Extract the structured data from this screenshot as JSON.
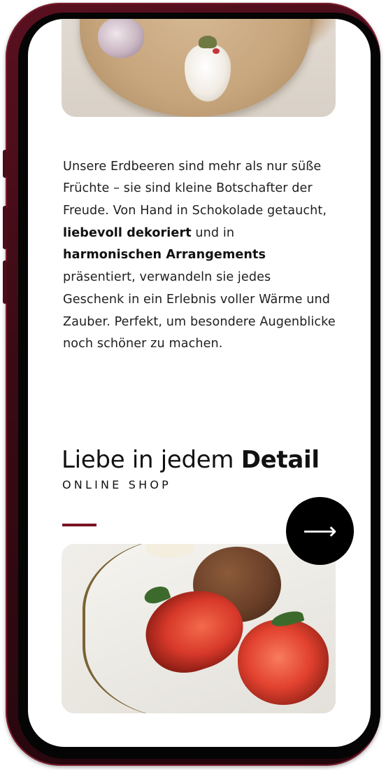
{
  "paragraph": {
    "part1": "Unsere Erdbeeren sind mehr als nur süße Früchte – sie sind kleine Botschafter der Freude. Von Hand in Schokolade getaucht, ",
    "bold1": "liebevoll dekoriert",
    "part2": " und in ",
    "bold2": "harmonischen Arrangements",
    "part3": " präsentiert, verwandeln sie jedes Geschenk in ein Erlebnis voller Wärme und Zauber. Perfekt, um besondere Augenblicke noch schöner zu machen."
  },
  "section": {
    "heading_regular": "Liebe in jedem ",
    "heading_bold": "Detail",
    "subtitle": "ONLINE SHOP",
    "accent_color": "#7a1325"
  },
  "cta": {
    "icon": "arrow-right-icon",
    "glyph": "⟶"
  },
  "images": {
    "top": "chocolate-covered-strawberries-on-wooden-board",
    "bottom": "halved-chocolate-strawberries-on-plate"
  },
  "colors": {
    "phone_frame": "#4a0d19",
    "button_bg": "#000000",
    "text": "#1f1f1f"
  }
}
